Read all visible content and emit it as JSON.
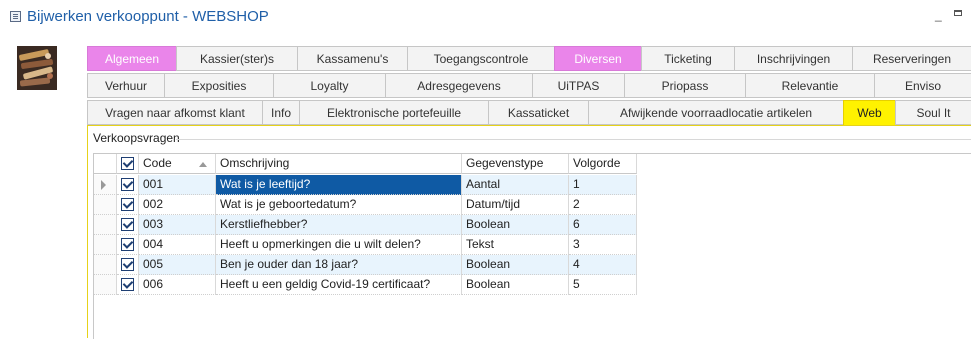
{
  "window": {
    "title": "Bijwerken verkooppunt - WEBSHOP",
    "minimize_glyph": "_"
  },
  "logo": {
    "icon": "brochures-image-icon"
  },
  "tabs": {
    "row1": [
      "Algemeen",
      "Kassier(ster)s",
      "Kassamenu's",
      "Toegangscontrole",
      "Diversen",
      "Ticketing",
      "Inschrijvingen",
      "Reserveringen"
    ],
    "row2": [
      "Verhuur",
      "Exposities",
      "Loyalty",
      "Adresgegevens",
      "UiTPAS",
      "Priopass",
      "Relevantie",
      "Enviso"
    ],
    "row3": [
      "Vragen naar afkomst klant",
      "Info",
      "Elektronische portefeuille",
      "Kassaticket",
      "Afwijkende voorraadlocatie artikelen",
      "Web",
      "Soul It"
    ],
    "highlight_pink": [
      "Algemeen",
      "Diversen"
    ],
    "active": "Web",
    "colors": {
      "pink": "#ea85ea",
      "active": "#fff200"
    }
  },
  "group": {
    "title": "Verkoopsvragen"
  },
  "grid": {
    "headers": {
      "code": "Code",
      "omschrijving": "Omschrijving",
      "gegevenstype": "Gegevenstype",
      "volgorde": "Volgorde"
    },
    "header_checked": true,
    "selected_row": 0,
    "rows": [
      {
        "checked": true,
        "code": "001",
        "omschrijving": "Wat is je leeftijd?",
        "gegevenstype": "Aantal",
        "volgorde": "1"
      },
      {
        "checked": true,
        "code": "002",
        "omschrijving": "Wat is je geboortedatum?",
        "gegevenstype": "Datum/tijd",
        "volgorde": "2"
      },
      {
        "checked": true,
        "code": "003",
        "omschrijving": "Kerstliefhebber?",
        "gegevenstype": "Boolean",
        "volgorde": "6"
      },
      {
        "checked": true,
        "code": "004",
        "omschrijving": "Heeft u opmerkingen die u wilt delen?",
        "gegevenstype": "Tekst",
        "volgorde": "3"
      },
      {
        "checked": true,
        "code": "005",
        "omschrijving": "Ben je ouder dan 18 jaar?",
        "gegevenstype": "Boolean",
        "volgorde": "4"
      },
      {
        "checked": true,
        "code": "006",
        "omschrijving": "Heeft u een geldig Covid-19 certificaat?",
        "gegevenstype": "Boolean",
        "volgorde": "5"
      }
    ]
  }
}
